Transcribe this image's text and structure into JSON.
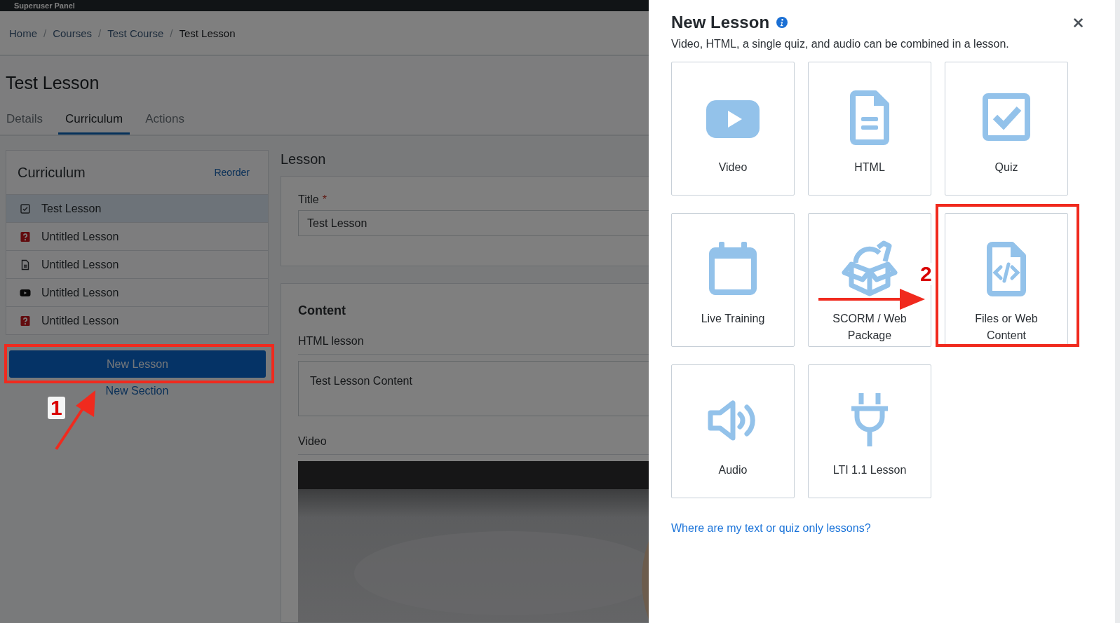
{
  "top_bar": {
    "label": "Superuser Panel"
  },
  "breadcrumb": {
    "separator": "/",
    "items": [
      {
        "label": "Home",
        "current": false
      },
      {
        "label": "Courses",
        "current": false
      },
      {
        "label": "Test Course",
        "current": false
      },
      {
        "label": "Test Lesson",
        "current": true
      }
    ]
  },
  "page_title": "Test Lesson",
  "tabs": [
    {
      "label": "Details",
      "selected": false
    },
    {
      "label": "Curriculum",
      "selected": true
    },
    {
      "label": "Actions",
      "selected": false
    }
  ],
  "curriculum": {
    "title": "Curriculum",
    "reorder_link": "Reorder",
    "items": [
      {
        "kind": "check",
        "label": "Test Lesson",
        "selected": true
      },
      {
        "kind": "question",
        "label": "Untitled Lesson",
        "selected": false
      },
      {
        "kind": "document",
        "label": "Untitled Lesson",
        "selected": false
      },
      {
        "kind": "video",
        "label": "Untitled Lesson",
        "selected": false
      },
      {
        "kind": "question",
        "label": "Untitled Lesson",
        "selected": false
      }
    ],
    "new_lesson_button": "New Lesson",
    "new_lesson_highlight": {
      "number": "1"
    },
    "new_section_link": "New Section"
  },
  "lesson_form": {
    "heading": "Lesson",
    "title_label": "Title",
    "required_mark": "*",
    "title_value": "Test Lesson",
    "content_heading": "Content",
    "html_label": "HTML lesson",
    "html_value": "Test Lesson Content",
    "video_label": "Video"
  },
  "modal": {
    "title": "New Lesson",
    "subtitle": "Video, HTML, a single quiz, and audio can be combined in a lesson.",
    "tiles": [
      {
        "kind": "video",
        "label": "Video"
      },
      {
        "kind": "html",
        "label": "HTML"
      },
      {
        "kind": "quiz",
        "label": "Quiz"
      },
      {
        "kind": "calendar",
        "label": "Live Training"
      },
      {
        "kind": "package",
        "label": "SCORM / Web Package"
      },
      {
        "kind": "code-file",
        "label": "Files or Web Content",
        "highlight": {
          "number": "2"
        }
      },
      {
        "kind": "audio",
        "label": "Audio"
      },
      {
        "kind": "plug",
        "label": "LTI 1.1 Lesson"
      }
    ],
    "help_link": "Where are my text or quiz only lessons?"
  }
}
